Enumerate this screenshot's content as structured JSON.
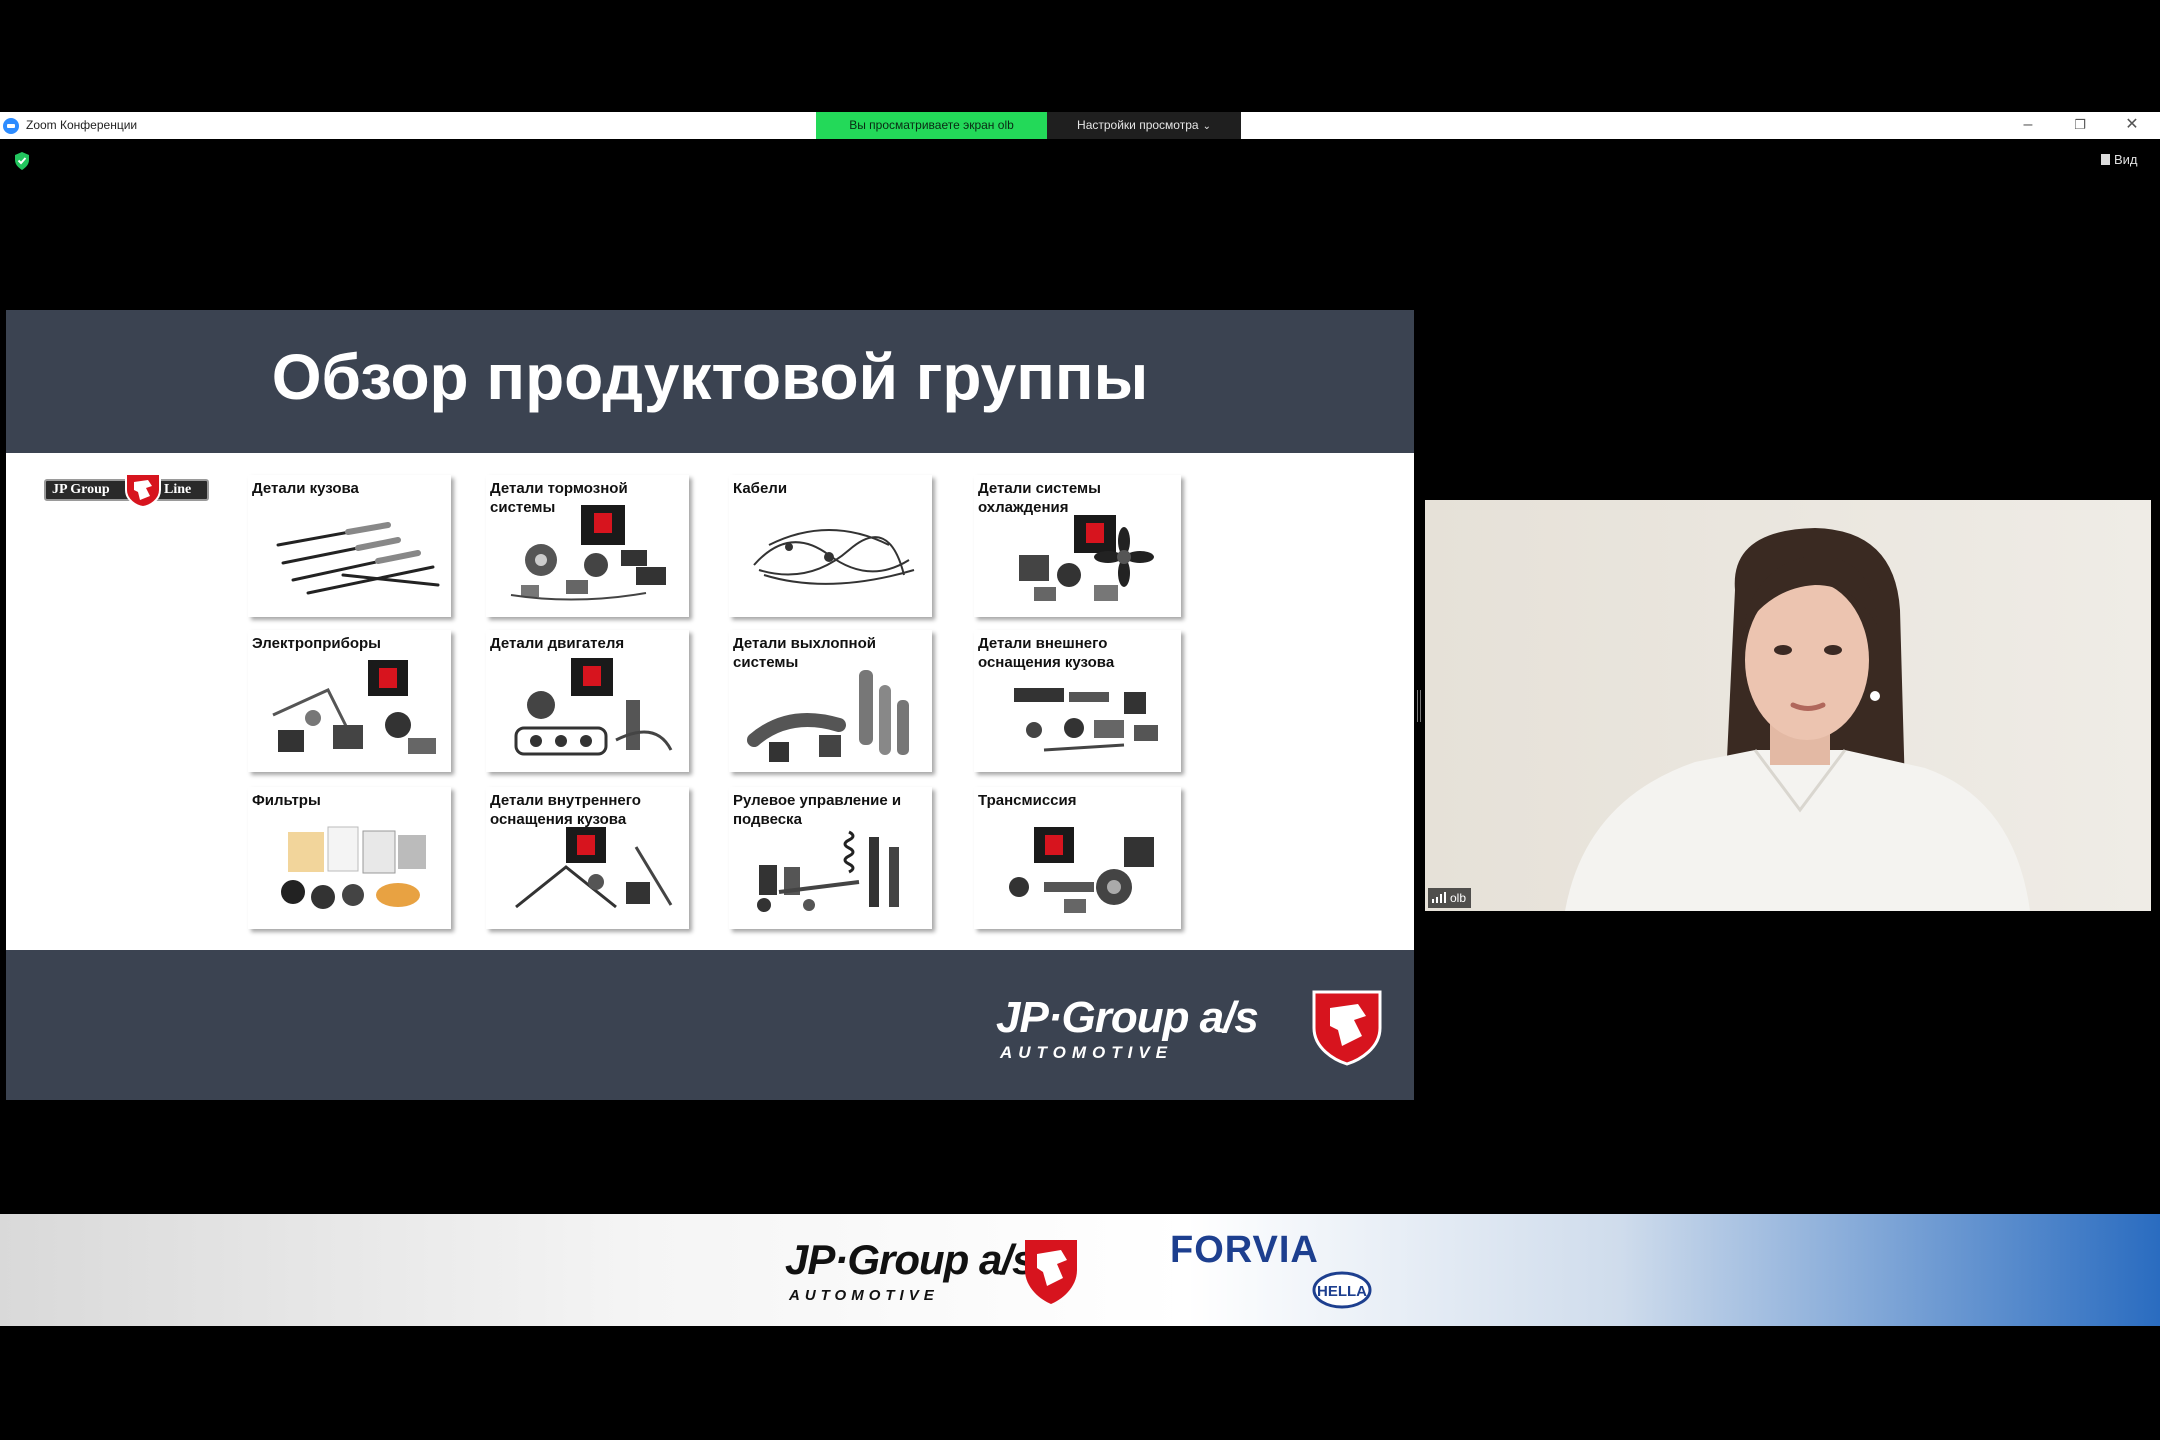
{
  "window": {
    "title": "Zoom Конференции",
    "share_status": "Вы просматриваете экран olb",
    "view_options": "Настройки просмотра",
    "view_button": "Вид"
  },
  "slide": {
    "title": "Обзор продуктовой группы",
    "line_logo": {
      "left": "JP Group",
      "right": "Line"
    },
    "categories": [
      "Детали кузова",
      "Детали тормозной системы",
      "Кабели",
      "Детали системы охлаждения",
      "Электроприборы",
      "Детали двигателя",
      "Детали выхлопной системы",
      "Детали внешнего оснащения кузова",
      "Фильтры",
      "Детали внутреннего оснащения кузова",
      "Рулевое управление и подвеска",
      "Трансмиссия"
    ],
    "footer_logo": {
      "main": "JP·Group a/s",
      "sub": "AUTOMOTIVE"
    }
  },
  "video": {
    "participant_name": "olb"
  },
  "banner": {
    "jp_main": "JP·Group a/s",
    "jp_sub": "AUTOMOTIVE",
    "forvia": "FORVIA",
    "hella": "HELLA"
  },
  "colors": {
    "slide_band": "#3b4351",
    "share_green": "#23d959",
    "brand_red": "#d7141e",
    "forvia_blue": "#1d3f8f"
  }
}
